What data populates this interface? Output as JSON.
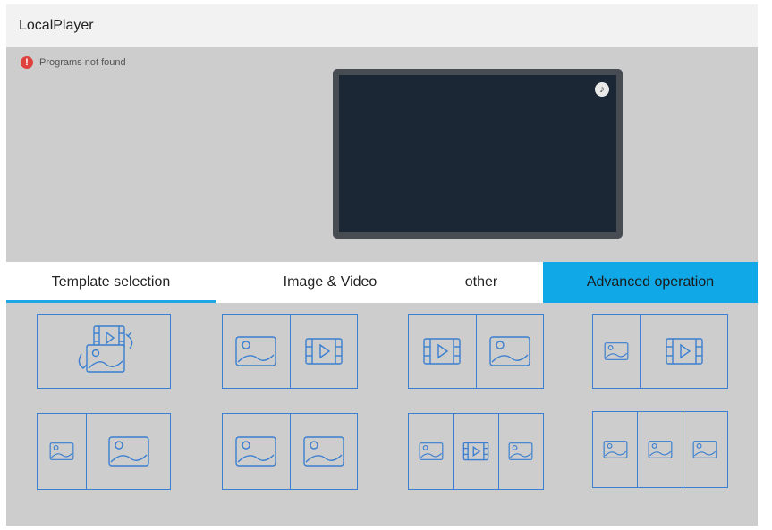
{
  "app": {
    "title": "LocalPlayer"
  },
  "status": {
    "message": "Programs not found",
    "icon": "error-icon",
    "color": "#e0413d"
  },
  "preview": {
    "icon": "music-note-icon"
  },
  "tabs": [
    {
      "label": "Template selection",
      "active": true
    },
    {
      "label": "Image & Video"
    },
    {
      "label": "other"
    },
    {
      "label": "Advanced operation",
      "highlighted": true
    }
  ],
  "colors": {
    "accent": "#11a8e8",
    "template_border": "#3a7fd0",
    "screen": "#1b2735"
  },
  "templates": [
    {
      "name": "template-rotate-image-video",
      "cells": [
        "swap"
      ]
    },
    {
      "name": "template-image-video",
      "cells": [
        "image",
        "video"
      ]
    },
    {
      "name": "template-video-image",
      "cells": [
        "video",
        "image"
      ]
    },
    {
      "name": "template-small-image-video",
      "cells": [
        "image-small",
        "video"
      ]
    },
    {
      "name": "template-small-image-image",
      "cells": [
        "image-small",
        "image"
      ]
    },
    {
      "name": "template-image-image",
      "cells": [
        "image",
        "image"
      ]
    },
    {
      "name": "template-image-video-image",
      "cells": [
        "image-small",
        "video-small",
        "image-small"
      ]
    },
    {
      "name": "template-three-images",
      "cells": [
        "image-small",
        "image-small",
        "image-small"
      ]
    }
  ]
}
